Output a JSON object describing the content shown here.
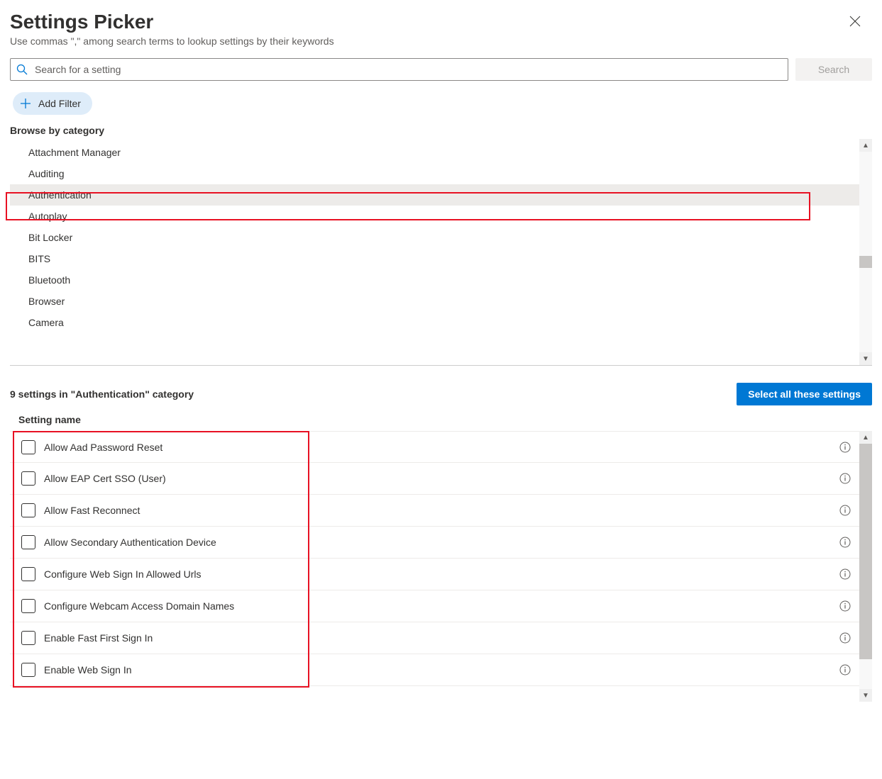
{
  "header": {
    "title": "Settings Picker",
    "subtitle": "Use commas \",\" among search terms to lookup settings by their keywords"
  },
  "search": {
    "placeholder": "Search for a setting",
    "button_label": "Search"
  },
  "filter_button": "Add Filter",
  "browse_label": "Browse by category",
  "categories": [
    "Attachment Manager",
    "Auditing",
    "Authentication",
    "Autoplay",
    "Bit Locker",
    "BITS",
    "Bluetooth",
    "Browser",
    "Camera"
  ],
  "selected_category_index": 2,
  "results_header": "9 settings in \"Authentication\" category",
  "select_all_label": "Select all these settings",
  "setting_name_column": "Setting name",
  "settings": [
    "Allow Aad Password Reset",
    "Allow EAP Cert SSO (User)",
    "Allow Fast Reconnect",
    "Allow Secondary Authentication Device",
    "Configure Web Sign In Allowed Urls",
    "Configure Webcam Access Domain Names",
    "Enable Fast First Sign In",
    "Enable Web Sign In"
  ]
}
